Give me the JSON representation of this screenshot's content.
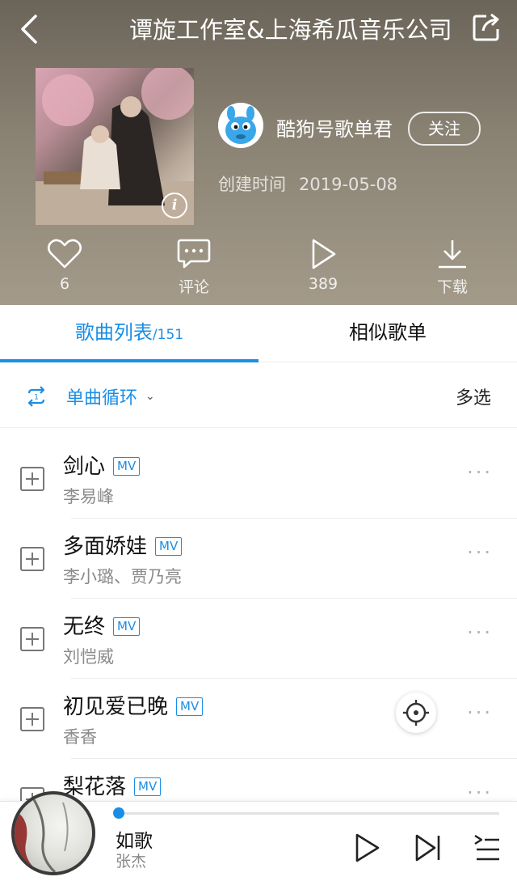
{
  "header": {
    "title": "谭旋工作室&上海希瓜音乐公司",
    "creator": {
      "name": "酷狗号歌单君",
      "follow_label": "关注"
    },
    "created": {
      "label": "创建时间",
      "date": "2019-05-08"
    },
    "actions": [
      {
        "icon": "heart-icon",
        "label": "6"
      },
      {
        "icon": "comment-icon",
        "label": "评论"
      },
      {
        "icon": "play-icon",
        "label": "389"
      },
      {
        "icon": "download-icon",
        "label": "下载"
      }
    ]
  },
  "tabs": {
    "songs_label": "歌曲列表",
    "songs_count": "/151",
    "similar_label": "相似歌单"
  },
  "controls": {
    "loop_label": "单曲循环",
    "multi_select_label": "多选"
  },
  "songs": [
    {
      "name": "剑心",
      "mv": "MV",
      "artist": "李易峰"
    },
    {
      "name": "多面娇娃",
      "mv": "MV",
      "artist": "李小璐、贾乃亮"
    },
    {
      "name": "无终",
      "mv": "MV",
      "artist": "刘恺威"
    },
    {
      "name": "初见爱已晚",
      "mv": "MV",
      "artist": "香香"
    },
    {
      "name": "梨花落",
      "mv": "MV",
      "artist": ""
    }
  ],
  "player": {
    "title": "如歌",
    "artist": "张杰",
    "progress": 0.0
  },
  "colors": {
    "accent": "#1a8ee6"
  }
}
